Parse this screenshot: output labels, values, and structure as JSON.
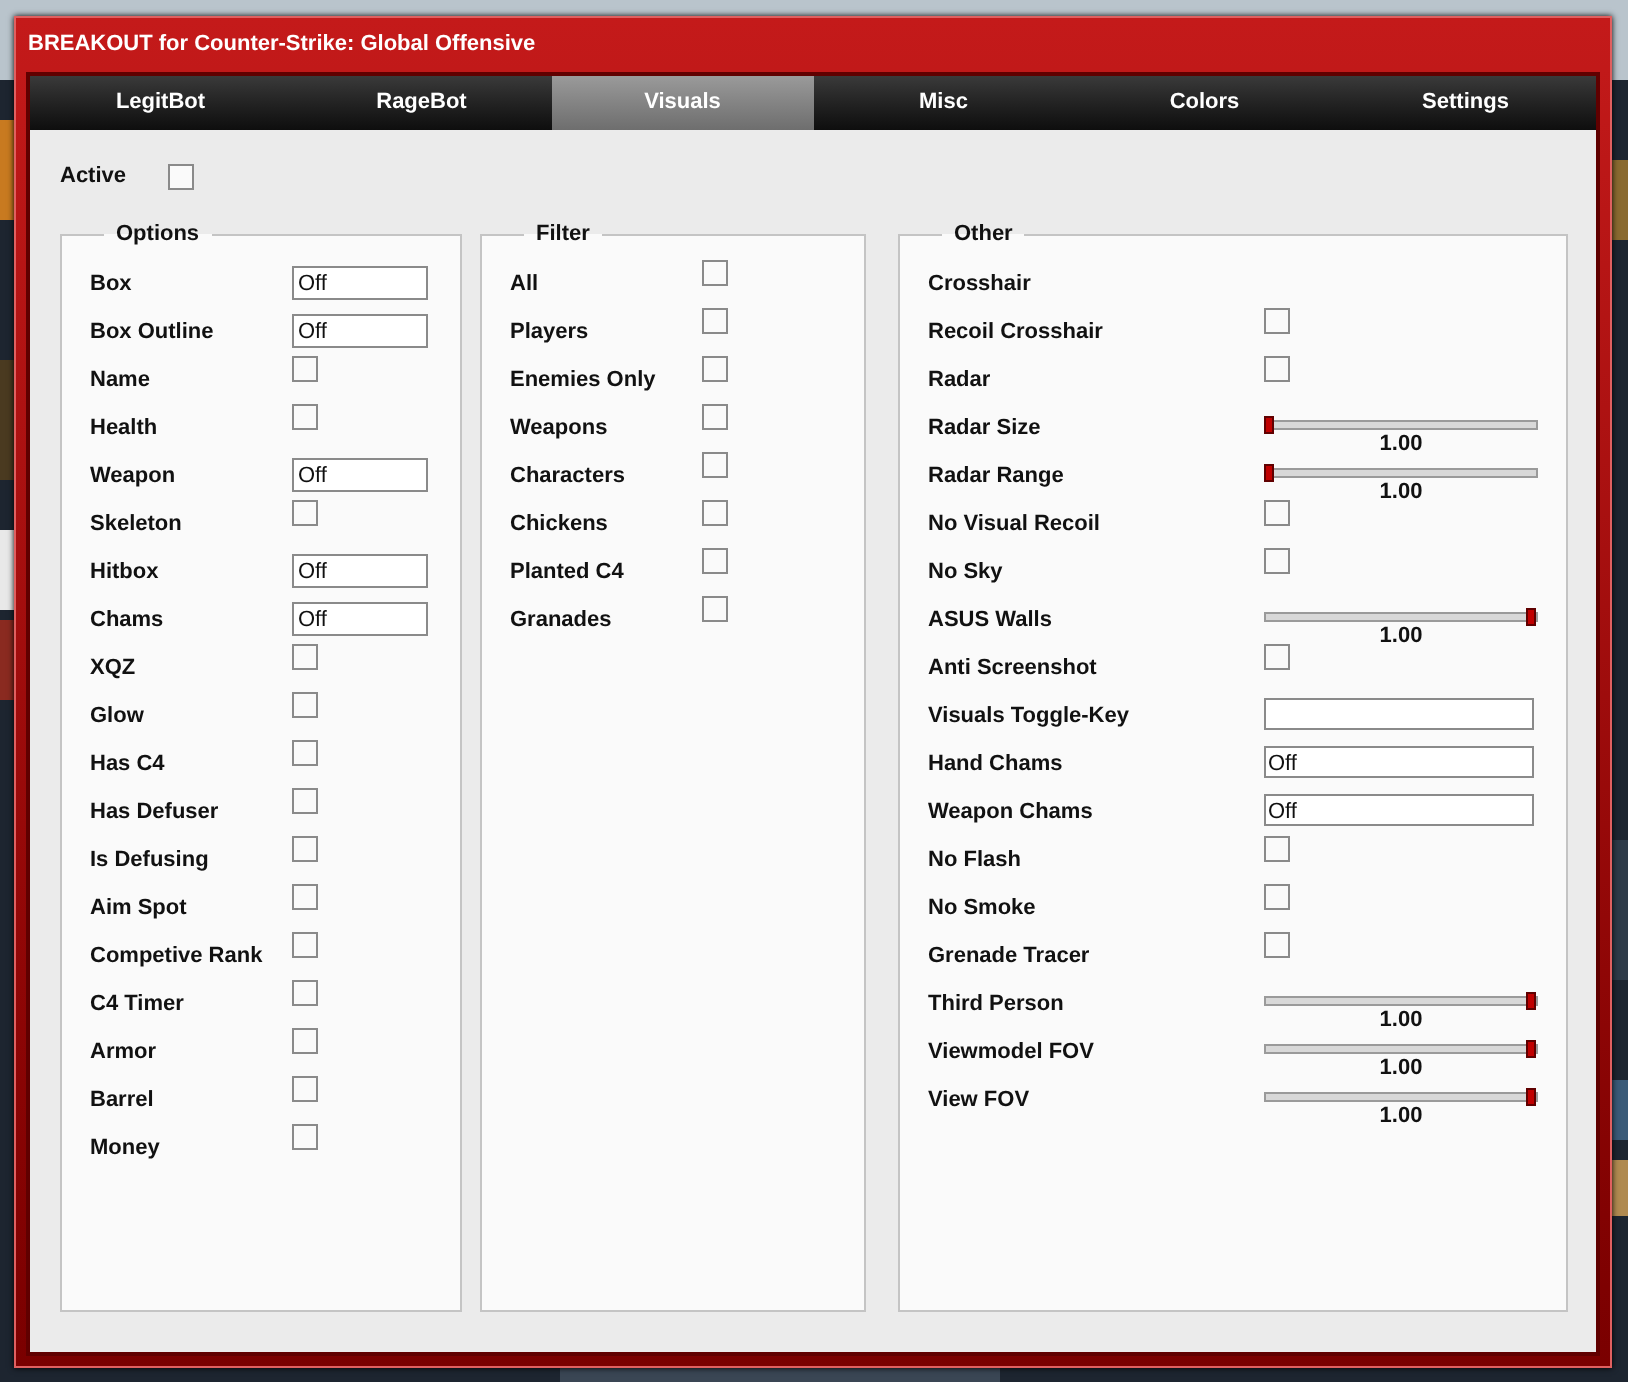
{
  "window": {
    "title": "BREAKOUT for Counter-Strike: Global Offensive"
  },
  "tabs": [
    {
      "label": "LegitBot",
      "selected": false
    },
    {
      "label": "RageBot",
      "selected": false
    },
    {
      "label": "Visuals",
      "selected": true
    },
    {
      "label": "Misc",
      "selected": false
    },
    {
      "label": "Colors",
      "selected": false
    },
    {
      "label": "Settings",
      "selected": false
    }
  ],
  "active": {
    "label": "Active",
    "checked": false
  },
  "groups": [
    {
      "title": "Options",
      "items": [
        {
          "kind": "select",
          "label": "Box",
          "value": "Off"
        },
        {
          "kind": "select",
          "label": "Box Outline",
          "value": "Off"
        },
        {
          "kind": "checkbox",
          "label": "Name",
          "checked": false
        },
        {
          "kind": "checkbox",
          "label": "Health",
          "checked": false
        },
        {
          "kind": "select",
          "label": "Weapon",
          "value": "Off"
        },
        {
          "kind": "checkbox",
          "label": "Skeleton",
          "checked": false
        },
        {
          "kind": "select",
          "label": "Hitbox",
          "value": "Off"
        },
        {
          "kind": "select",
          "label": "Chams",
          "value": "Off"
        },
        {
          "kind": "checkbox",
          "label": "XQZ",
          "checked": false
        },
        {
          "kind": "checkbox",
          "label": "Glow",
          "checked": false
        },
        {
          "kind": "checkbox",
          "label": "Has C4",
          "checked": false
        },
        {
          "kind": "checkbox",
          "label": "Has Defuser",
          "checked": false
        },
        {
          "kind": "checkbox",
          "label": "Is Defusing",
          "checked": false
        },
        {
          "kind": "checkbox",
          "label": "Aim Spot",
          "checked": false
        },
        {
          "kind": "checkbox",
          "label": "Competive Rank",
          "checked": false
        },
        {
          "kind": "checkbox",
          "label": "C4 Timer",
          "checked": false
        },
        {
          "kind": "checkbox",
          "label": "Armor",
          "checked": false
        },
        {
          "kind": "checkbox",
          "label": "Barrel",
          "checked": false
        },
        {
          "kind": "checkbox",
          "label": "Money",
          "checked": false
        }
      ]
    },
    {
      "title": "Filter",
      "items": [
        {
          "kind": "checkbox",
          "label": "All",
          "checked": false
        },
        {
          "kind": "checkbox",
          "label": "Players",
          "checked": false
        },
        {
          "kind": "checkbox",
          "label": "Enemies Only",
          "checked": false
        },
        {
          "kind": "checkbox",
          "label": "Weapons",
          "checked": false
        },
        {
          "kind": "checkbox",
          "label": "Characters",
          "checked": false
        },
        {
          "kind": "checkbox",
          "label": "Chickens",
          "checked": false
        },
        {
          "kind": "checkbox",
          "label": "Planted C4",
          "checked": false
        },
        {
          "kind": "checkbox",
          "label": "Granades",
          "checked": false
        }
      ]
    },
    {
      "title": "Other",
      "items": [
        {
          "kind": "label",
          "label": "Crosshair"
        },
        {
          "kind": "checkbox",
          "label": "Recoil Crosshair",
          "checked": false
        },
        {
          "kind": "checkbox",
          "label": "Radar",
          "checked": false
        },
        {
          "kind": "slider",
          "label": "Radar Size",
          "level": 0,
          "reading": "1.00"
        },
        {
          "kind": "slider",
          "label": "Radar Range",
          "level": 0,
          "reading": "1.00"
        },
        {
          "kind": "checkbox",
          "label": "No Visual Recoil",
          "checked": false
        },
        {
          "kind": "checkbox",
          "label": "No Sky",
          "checked": false
        },
        {
          "kind": "slider",
          "label": "ASUS Walls",
          "level": 1,
          "reading": "1.00"
        },
        {
          "kind": "checkbox",
          "label": "Anti Screenshot",
          "checked": false
        },
        {
          "kind": "field",
          "label": "Visuals Toggle-Key"
        },
        {
          "kind": "field",
          "label": "Hand Chams",
          "value": "Off"
        },
        {
          "kind": "field",
          "label": "Weapon Chams",
          "value": "Off"
        },
        {
          "kind": "checkbox",
          "label": "No Flash",
          "checked": false
        },
        {
          "kind": "checkbox",
          "label": "No Smoke",
          "checked": false
        },
        {
          "kind": "checkbox",
          "label": "Grenade Tracer",
          "checked": false
        },
        {
          "kind": "slider",
          "label": "Third Person",
          "level": 1,
          "reading": "1.00"
        },
        {
          "kind": "slider",
          "label": "Viewmodel FOV",
          "level": 1,
          "reading": "1.00"
        },
        {
          "kind": "slider",
          "label": "View FOV",
          "level": 1,
          "reading": "1.00"
        }
      ]
    }
  ]
}
